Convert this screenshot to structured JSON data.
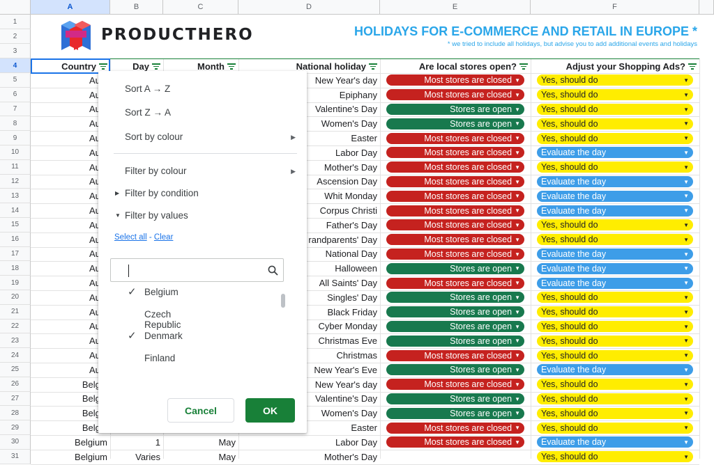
{
  "columns": [
    "A",
    "B",
    "C",
    "D",
    "E",
    "F"
  ],
  "row_numbers": [
    "1",
    "2",
    "3",
    "4",
    "5",
    "6",
    "7",
    "8",
    "9",
    "10",
    "11",
    "12",
    "13",
    "14",
    "15",
    "16",
    "17",
    "18",
    "19",
    "20",
    "21",
    "22",
    "23",
    "24",
    "25",
    "26",
    "27",
    "28",
    "29",
    "30",
    "31"
  ],
  "brand": "PRODUCTHERO",
  "title": "HOLIDAYS FOR E-COMMERCE AND RETAIL IN EUROPE *",
  "subtitle": "* we tried to include all holidays, but advise you to add additional events and holidays",
  "headers": {
    "country": "Country",
    "day": "Day",
    "month": "Month",
    "holiday": "National holiday",
    "stores": "Are local stores open?",
    "ads": "Adjust your Shopping Ads?"
  },
  "rows": [
    {
      "country": "Aust",
      "day": "",
      "month": "",
      "holiday": "New Year's day",
      "stores": "Most stores are closed",
      "ads": "Yes, should do"
    },
    {
      "country": "Aust",
      "day": "",
      "month": "",
      "holiday": "Epiphany",
      "stores": "Most stores are closed",
      "ads": "Yes, should do"
    },
    {
      "country": "Aust",
      "day": "",
      "month": "",
      "holiday": "Valentine's Day",
      "stores": "Stores are open",
      "ads": "Yes, should do"
    },
    {
      "country": "Aust",
      "day": "",
      "month": "",
      "holiday": "Women's Day",
      "stores": "Stores are open",
      "ads": "Yes, should do"
    },
    {
      "country": "Aust",
      "day": "",
      "month": "",
      "holiday": "Easter",
      "stores": "Most stores are closed",
      "ads": "Yes, should do"
    },
    {
      "country": "Aust",
      "day": "",
      "month": "",
      "holiday": "Labor Day",
      "stores": "Most stores are closed",
      "ads": "Evaluate the day"
    },
    {
      "country": "Aust",
      "day": "",
      "month": "",
      "holiday": "Mother's Day",
      "stores": "Most stores are closed",
      "ads": "Yes, should do"
    },
    {
      "country": "Aust",
      "day": "",
      "month": "",
      "holiday": "Ascension Day",
      "stores": "Most stores are closed",
      "ads": "Evaluate the day"
    },
    {
      "country": "Aust",
      "day": "",
      "month": "",
      "holiday": "Whit Monday",
      "stores": "Most stores are closed",
      "ads": "Evaluate the day"
    },
    {
      "country": "Aust",
      "day": "",
      "month": "",
      "holiday": "Corpus Christi",
      "stores": "Most stores are closed",
      "ads": "Evaluate the day"
    },
    {
      "country": "Aust",
      "day": "",
      "month": "",
      "holiday": "Father's Day",
      "stores": "Most stores are closed",
      "ads": "Yes, should do"
    },
    {
      "country": "Aust",
      "day": "",
      "month": "",
      "holiday": "randparents' Day",
      "stores": "Most stores are closed",
      "ads": "Yes, should do"
    },
    {
      "country": "Aust",
      "day": "",
      "month": "",
      "holiday": "National Day",
      "stores": "Most stores are closed",
      "ads": "Evaluate the day"
    },
    {
      "country": "Aust",
      "day": "",
      "month": "",
      "holiday": "Halloween",
      "stores": "Stores are open",
      "ads": "Evaluate the day"
    },
    {
      "country": "Aust",
      "day": "",
      "month": "",
      "holiday": "All Saints' Day",
      "stores": "Most stores are closed",
      "ads": "Evaluate the day"
    },
    {
      "country": "Aust",
      "day": "",
      "month": "",
      "holiday": "Singles' Day",
      "stores": "Stores are open",
      "ads": "Yes, should do"
    },
    {
      "country": "Aust",
      "day": "",
      "month": "",
      "holiday": "Black Friday",
      "stores": "Stores are open",
      "ads": "Yes, should do"
    },
    {
      "country": "Aust",
      "day": "",
      "month": "",
      "holiday": "Cyber Monday",
      "stores": "Stores are open",
      "ads": "Yes, should do"
    },
    {
      "country": "Aust",
      "day": "",
      "month": "",
      "holiday": "Christmas Eve",
      "stores": "Stores are open",
      "ads": "Yes, should do"
    },
    {
      "country": "Aust",
      "day": "",
      "month": "",
      "holiday": "Christmas",
      "stores": "Most stores are closed",
      "ads": "Yes, should do"
    },
    {
      "country": "Aust",
      "day": "",
      "month": "",
      "holiday": "New Year's Eve",
      "stores": "Stores are open",
      "ads": "Evaluate the day"
    },
    {
      "country": "Belgiu",
      "day": "",
      "month": "",
      "holiday": "New Year's day",
      "stores": "Most stores are closed",
      "ads": "Yes, should do"
    },
    {
      "country": "Belgiu",
      "day": "",
      "month": "",
      "holiday": "Valentine's Day",
      "stores": "Stores are open",
      "ads": "Yes, should do"
    },
    {
      "country": "Belgiu",
      "day": "",
      "month": "",
      "holiday": "Women's Day",
      "stores": "Stores are open",
      "ads": "Yes, should do"
    },
    {
      "country": "Belgiu",
      "day": "",
      "month": "",
      "holiday": "Easter",
      "stores": "Most stores are closed",
      "ads": "Yes, should do"
    },
    {
      "country": "Belgium",
      "day": "1",
      "month": "May",
      "holiday": "Labor Day",
      "stores": "Most stores are closed",
      "ads": "Evaluate the day"
    },
    {
      "country": "Belgium",
      "day": "Varies",
      "month": "May",
      "holiday": "Mother's Day",
      "stores": "",
      "ads": "Yes, should do"
    }
  ],
  "menu": {
    "sort_az": "Sort A → Z",
    "sort_za": "Sort Z → A",
    "sort_colour": "Sort by colour",
    "filter_colour": "Filter by colour",
    "filter_condition": "Filter by condition",
    "filter_values": "Filter by values",
    "select_all": "Select all",
    "separator": "-",
    "clear": "Clear",
    "search_value": "",
    "values": [
      {
        "label": "Belgium",
        "checked": true
      },
      {
        "label": "Czech Republic",
        "checked": false
      },
      {
        "label": "Denmark",
        "checked": true
      },
      {
        "label": "Finland",
        "checked": false
      }
    ],
    "check_glyph": "✓",
    "cancel": "Cancel",
    "ok": "OK"
  },
  "colors": {
    "closed": "#c5221f",
    "open": "#18794e",
    "yes": "#ffed00",
    "evaluate": "#3d9de8",
    "accent": "#188038",
    "title": "#2aa6e9"
  }
}
